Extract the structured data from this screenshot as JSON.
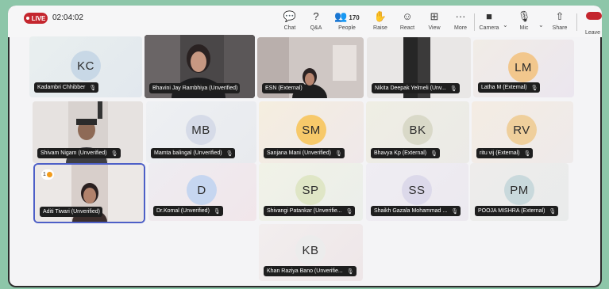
{
  "toolbar": {
    "live_label": "LIVE",
    "timer": "02:04:02",
    "tools": [
      {
        "icon": "chat-icon",
        "glyph": "💬",
        "label": "Chat"
      },
      {
        "icon": "qa-icon",
        "glyph": "?",
        "label": "Q&A"
      },
      {
        "icon": "people-icon",
        "glyph": "👥",
        "label": "People",
        "count": "170"
      },
      {
        "icon": "raise-hand-icon",
        "glyph": "✋",
        "label": "Raise"
      },
      {
        "icon": "react-icon",
        "glyph": "☺",
        "label": "React"
      },
      {
        "icon": "view-icon",
        "glyph": "⊞",
        "label": "View"
      },
      {
        "icon": "more-icon",
        "glyph": "···",
        "label": "More"
      },
      {
        "icon": "camera-off-icon",
        "glyph": "■",
        "label": "Camera"
      },
      {
        "icon": "mic-off-icon",
        "glyph": "🎙",
        "label": "Mic"
      },
      {
        "icon": "share-icon",
        "glyph": "⇧",
        "label": "Share"
      }
    ],
    "leave_label": "Leave"
  },
  "participants": [
    {
      "name": "Kadambri Chhibber",
      "initials": "KC",
      "avatar_color": "#c8d8e6",
      "type": "avatar"
    },
    {
      "name": "Bhavini Jay Rambhiya (Unverified)",
      "initials": "",
      "type": "video"
    },
    {
      "name": "ESN (External)",
      "initials": "",
      "type": "video"
    },
    {
      "name": "Nikita Deepak Yelmeli (Unv...",
      "initials": "",
      "type": "video"
    },
    {
      "name": "Latha M (External)",
      "initials": "LM",
      "avatar_color": "#f2c78d",
      "type": "avatar"
    },
    {
      "name": "Shivam Nigam (Unverified)",
      "initials": "",
      "type": "video"
    },
    {
      "name": "Mamta balingal (Unverified)",
      "initials": "MB",
      "avatar_color": "#d6dbe8",
      "type": "avatar"
    },
    {
      "name": "Sanjana Mani (Unverified)",
      "initials": "SM",
      "avatar_color": "#f7c96a",
      "type": "avatar"
    },
    {
      "name": "Bhavya Kp (External)",
      "initials": "BK",
      "avatar_color": "#d9d9c8",
      "type": "avatar"
    },
    {
      "name": "ritu vij (External)",
      "initials": "RV",
      "avatar_color": "#efcf9c",
      "type": "avatar"
    },
    {
      "name": "Aditi Tiwari (Unverified)",
      "initials": "",
      "type": "video",
      "hand": "1"
    },
    {
      "name": "Dr.Komal (Unverified)",
      "initials": "D",
      "avatar_color": "#c6d6f0",
      "type": "avatar"
    },
    {
      "name": "Shivangi Patankar (Unverifie...",
      "initials": "SP",
      "avatar_color": "#dfe6c6",
      "type": "avatar"
    },
    {
      "name": "Shaikh Gazala Mohammad ...",
      "initials": "SS",
      "avatar_color": "#dcd9ea",
      "type": "avatar"
    },
    {
      "name": "POOJA MISHRA (External)",
      "initials": "PM",
      "avatar_color": "#c9d9dc",
      "type": "avatar"
    },
    {
      "name": "Khan Raziya Bano (Unverifie...",
      "initials": "KB",
      "avatar_color": "#ececec",
      "type": "avatar"
    }
  ]
}
